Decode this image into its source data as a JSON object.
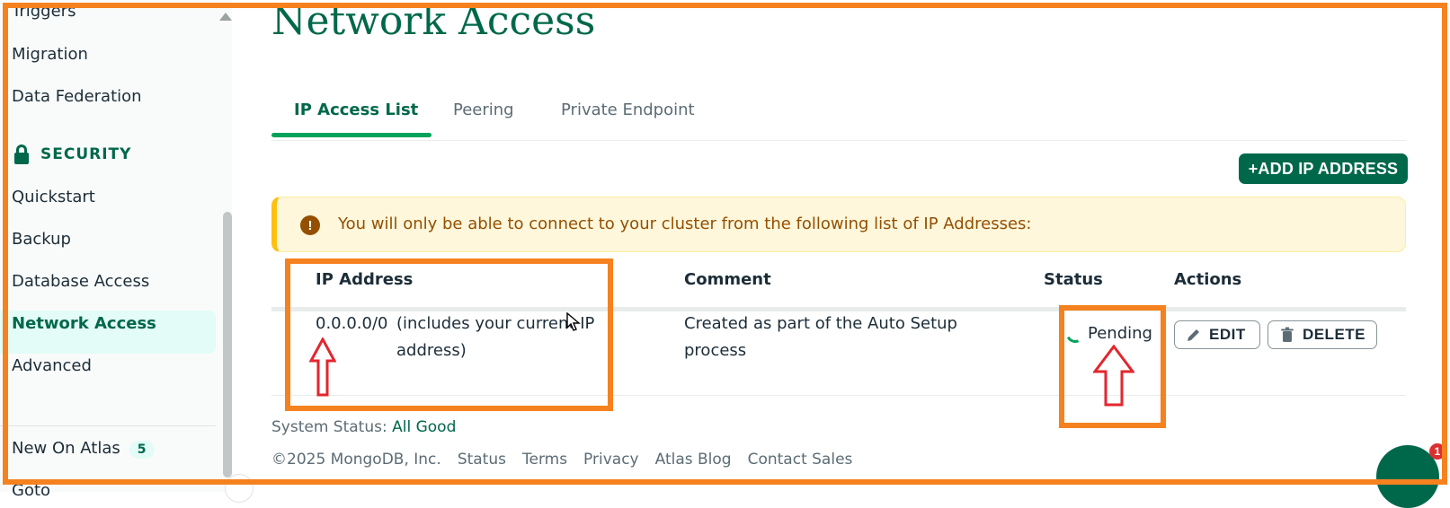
{
  "sidebar": {
    "items_top": [
      "Triggers",
      "Migration",
      "Data Federation"
    ],
    "security_header": "SECURITY",
    "security_items": [
      "Quickstart",
      "Backup",
      "Database Access",
      "Network Access",
      "Advanced"
    ],
    "active_item": "Network Access",
    "new_on_atlas": {
      "label": "New On Atlas",
      "count": "5"
    },
    "bottom_item": "Goto"
  },
  "page": {
    "title": "Network Access",
    "tabs": [
      "IP Access List",
      "Peering",
      "Private Endpoint"
    ],
    "active_tab": "IP Access List",
    "add_button": "+ADD IP ADDRESS",
    "banner_icon": "!",
    "banner_text": "You will only be able to connect to your cluster from the following list of IP Addresses:"
  },
  "table": {
    "columns": [
      "IP Address",
      "Comment",
      "Status",
      "Actions"
    ],
    "rows": [
      {
        "ip": "0.0.0.0/0",
        "ip_note": "(includes your current IP address)",
        "comment": "Created as part of the Auto Setup process",
        "status": "Pending",
        "edit_label": "EDIT",
        "delete_label": "DELETE"
      }
    ]
  },
  "footer": {
    "system_status_label": "System Status:",
    "system_status_value": "All Good",
    "copyright": "©2025 MongoDB, Inc.",
    "links": [
      "Status",
      "Terms",
      "Privacy",
      "Atlas Blog",
      "Contact Sales"
    ]
  },
  "chat": {
    "notification_count": "1"
  },
  "icons": {
    "security": "lock-icon",
    "banner": "exclamation-icon",
    "edit": "pencil-icon",
    "delete": "trash-icon",
    "chat": "chat-icon"
  },
  "colors": {
    "brand_green": "#00684a",
    "accent_green": "#00a35c",
    "warning_bg": "#fef7db",
    "annotation_orange": "#f5821f",
    "annotation_red": "#e3262e"
  }
}
